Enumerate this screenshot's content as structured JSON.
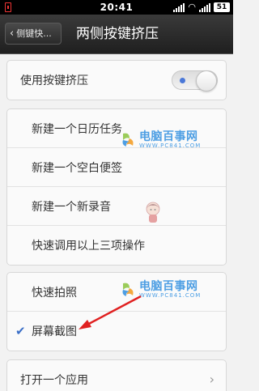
{
  "status_bar": {
    "time": "20:41",
    "battery": "51"
  },
  "header": {
    "back_label": "侧键快...",
    "title": "两侧按键挤压"
  },
  "toggle_row": {
    "label": "使用按键挤压",
    "enabled": true
  },
  "group1": {
    "items": [
      {
        "label": "新建一个日历任务"
      },
      {
        "label": "新建一个空白便签"
      },
      {
        "label": "新建一个新录音"
      },
      {
        "label": "快速调用以上三项操作"
      }
    ]
  },
  "group2": {
    "items": [
      {
        "label": "快速拍照",
        "checked": false
      },
      {
        "label": "屏幕截图",
        "checked": true
      }
    ]
  },
  "group3": {
    "items": [
      {
        "label": "打开一个应用"
      }
    ]
  },
  "watermark": {
    "name": "电脑百事网",
    "url": "WWW.PC841.COM"
  },
  "colors": {
    "accent": "#3b6fc7",
    "header_bg": "#2a2a2a",
    "arrow": "#e02020"
  }
}
